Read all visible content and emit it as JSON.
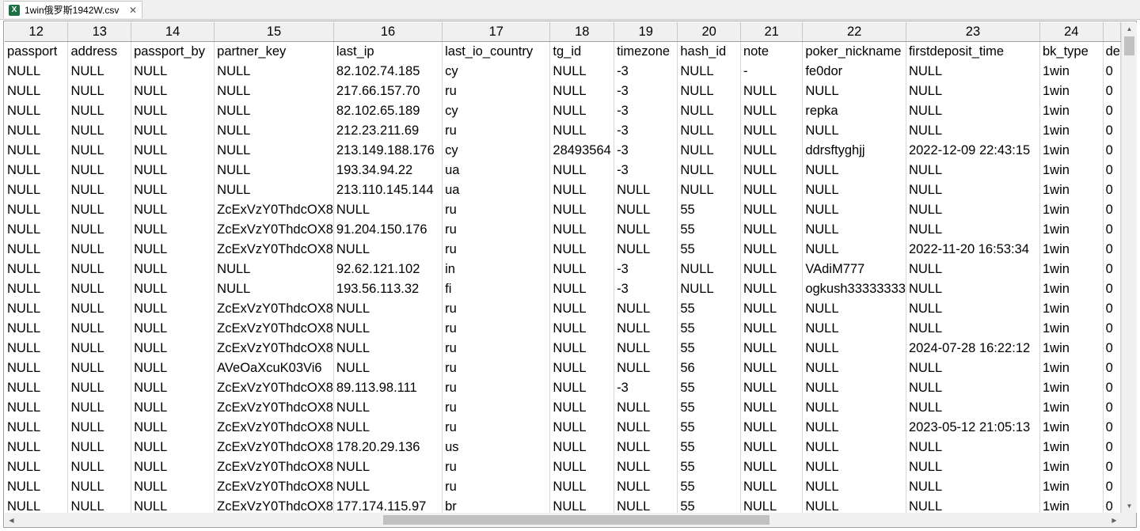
{
  "tab": {
    "icon": "excel-icon",
    "title": "1win俄罗斯1942W.csv",
    "close_label": "✕"
  },
  "column_numbers": [
    "12",
    "13",
    "14",
    "15",
    "16",
    "17",
    "18",
    "19",
    "20",
    "21",
    "22",
    "23",
    "24",
    ""
  ],
  "column_widths": [
    81,
    81,
    106,
    138,
    138,
    138,
    81,
    81,
    81,
    81,
    129,
    170,
    81,
    20
  ],
  "header_row": [
    "passport",
    "address",
    "passport_by",
    "partner_key",
    "last_ip",
    "last_io_country",
    "tg_id",
    "timezone",
    "hash_id",
    "note",
    "poker_nickname",
    "firstdeposit_time",
    "bk_type",
    "de"
  ],
  "rows": [
    [
      "NULL",
      "NULL",
      "NULL",
      "NULL",
      "82.102.74.185",
      "cy",
      "NULL",
      "-3",
      "NULL",
      "-",
      "fe0dor",
      "NULL",
      "1win",
      "0"
    ],
    [
      "NULL",
      "NULL",
      "NULL",
      "NULL",
      "217.66.157.70",
      "ru",
      "NULL",
      "-3",
      "NULL",
      "NULL",
      "NULL",
      "NULL",
      "1win",
      "0"
    ],
    [
      "NULL",
      "NULL",
      "NULL",
      "NULL",
      "82.102.65.189",
      "cy",
      "NULL",
      "-3",
      "NULL",
      "NULL",
      "repka",
      "NULL",
      "1win",
      "0"
    ],
    [
      "NULL",
      "NULL",
      "NULL",
      "NULL",
      "212.23.211.69",
      "ru",
      "NULL",
      "-3",
      "NULL",
      "NULL",
      "NULL",
      "NULL",
      "1win",
      "0"
    ],
    [
      "NULL",
      "NULL",
      "NULL",
      "NULL",
      "213.149.188.176",
      "cy",
      "28493564",
      "-3",
      "NULL",
      "NULL",
      "ddrsftyghjj",
      "2022-12-09 22:43:15",
      "1win",
      "0"
    ],
    [
      "NULL",
      "NULL",
      "NULL",
      "NULL",
      "193.34.94.22",
      "ua",
      "NULL",
      "-3",
      "NULL",
      "NULL",
      "NULL",
      "NULL",
      "1win",
      "0"
    ],
    [
      "NULL",
      "NULL",
      "NULL",
      "NULL",
      "213.110.145.144",
      "ua",
      "NULL",
      "NULL",
      "NULL",
      "NULL",
      "NULL",
      "NULL",
      "1win",
      "0"
    ],
    [
      "NULL",
      "NULL",
      "NULL",
      "ZcExVzY0ThdcOX8",
      "NULL",
      "ru",
      "NULL",
      "NULL",
      "55",
      "NULL",
      "NULL",
      "NULL",
      "1win",
      "0"
    ],
    [
      "NULL",
      "NULL",
      "NULL",
      "ZcExVzY0ThdcOX8",
      "91.204.150.176",
      "ru",
      "NULL",
      "NULL",
      "55",
      "NULL",
      "NULL",
      "NULL",
      "1win",
      "0"
    ],
    [
      "NULL",
      "NULL",
      "NULL",
      "ZcExVzY0ThdcOX8",
      "NULL",
      "ru",
      "NULL",
      "NULL",
      "55",
      "NULL",
      "NULL",
      "2022-11-20 16:53:34",
      "1win",
      "0"
    ],
    [
      "NULL",
      "NULL",
      "NULL",
      "NULL",
      "92.62.121.102",
      "in",
      "NULL",
      "-3",
      "NULL",
      "NULL",
      "VAdiM777",
      "NULL",
      "1win",
      "0"
    ],
    [
      "NULL",
      "NULL",
      "NULL",
      "NULL",
      "193.56.113.32",
      "fi",
      "NULL",
      "-3",
      "NULL",
      "NULL",
      "ogkush33333333",
      "NULL",
      "1win",
      "0"
    ],
    [
      "NULL",
      "NULL",
      "NULL",
      "ZcExVzY0ThdcOX8",
      "NULL",
      "ru",
      "NULL",
      "NULL",
      "55",
      "NULL",
      "NULL",
      "NULL",
      "1win",
      "0"
    ],
    [
      "NULL",
      "NULL",
      "NULL",
      "ZcExVzY0ThdcOX8",
      "NULL",
      "ru",
      "NULL",
      "NULL",
      "55",
      "NULL",
      "NULL",
      "NULL",
      "1win",
      "0"
    ],
    [
      "NULL",
      "NULL",
      "NULL",
      "ZcExVzY0ThdcOX8",
      "NULL",
      "ru",
      "NULL",
      "NULL",
      "55",
      "NULL",
      "NULL",
      "2024-07-28 16:22:12",
      "1win",
      "0"
    ],
    [
      "NULL",
      "NULL",
      "NULL",
      "AVeOaXcuK03Vi6",
      "NULL",
      "ru",
      "NULL",
      "NULL",
      "56",
      "NULL",
      "NULL",
      "NULL",
      "1win",
      "0"
    ],
    [
      "NULL",
      "NULL",
      "NULL",
      "ZcExVzY0ThdcOX8",
      "89.113.98.111",
      "ru",
      "NULL",
      "-3",
      "55",
      "NULL",
      "NULL",
      "NULL",
      "1win",
      "0"
    ],
    [
      "NULL",
      "NULL",
      "NULL",
      "ZcExVzY0ThdcOX8",
      "NULL",
      "ru",
      "NULL",
      "NULL",
      "55",
      "NULL",
      "NULL",
      "NULL",
      "1win",
      "0"
    ],
    [
      "NULL",
      "NULL",
      "NULL",
      "ZcExVzY0ThdcOX8",
      "NULL",
      "ru",
      "NULL",
      "NULL",
      "55",
      "NULL",
      "NULL",
      "2023-05-12 21:05:13",
      "1win",
      "0"
    ],
    [
      "NULL",
      "NULL",
      "NULL",
      "ZcExVzY0ThdcOX8",
      "178.20.29.136",
      "us",
      "NULL",
      "NULL",
      "55",
      "NULL",
      "NULL",
      "NULL",
      "1win",
      "0"
    ],
    [
      "NULL",
      "NULL",
      "NULL",
      "ZcExVzY0ThdcOX8",
      "NULL",
      "ru",
      "NULL",
      "NULL",
      "55",
      "NULL",
      "NULL",
      "NULL",
      "1win",
      "0"
    ],
    [
      "NULL",
      "NULL",
      "NULL",
      "ZcExVzY0ThdcOX8",
      "NULL",
      "ru",
      "NULL",
      "NULL",
      "55",
      "NULL",
      "NULL",
      "NULL",
      "1win",
      "0"
    ],
    [
      "NULL",
      "NULL",
      "NULL",
      "ZcExVzY0ThdcOX8",
      "177.174.115.97",
      "br",
      "NULL",
      "NULL",
      "55",
      "NULL",
      "NULL",
      "NULL",
      "1win",
      "0"
    ]
  ],
  "scrollbars": {
    "up": "▲",
    "down": "▼",
    "left": "◀",
    "right": "▶"
  }
}
